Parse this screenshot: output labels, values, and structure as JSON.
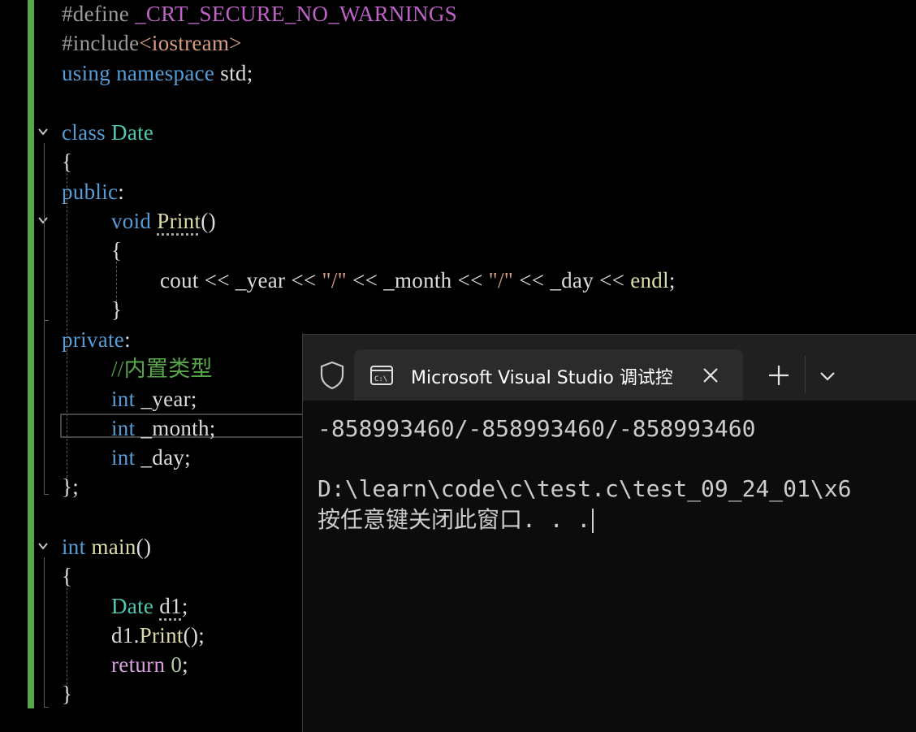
{
  "editor": {
    "lines": {
      "l1_pp": "#define",
      "l1_macro": "_CRT_SECURE_NO_WARNINGS",
      "l2_pp": "#include",
      "l2_header": "<iostream>",
      "l3_using": "using",
      "l3_namespace": "namespace",
      "l3_std": "std;",
      "l5_class": "class",
      "l5_name": "Date",
      "l6": "{",
      "l7_public": "public",
      "l7_colon": ":",
      "l8_void": "void",
      "l8_fn": "Print",
      "l8_parens": "()",
      "l9": "{",
      "l10_cout": "cout",
      "l10_op1": "<<",
      "l10_year": "_year",
      "l10_op2": "<<",
      "l10_str1": "\"/\"",
      "l10_op3": "<<",
      "l10_month": "_month",
      "l10_op4": "<<",
      "l10_str2": "\"/\"",
      "l10_op5": "<<",
      "l10_day": "_day",
      "l10_op6": "<<",
      "l10_endl": "endl",
      "l10_semi": ";",
      "l11": "}",
      "l12_private": "private",
      "l12_colon": ":",
      "l13_comment": "//内置类型",
      "l14_int": "int",
      "l14_var": "_year;",
      "l15_int": "int",
      "l15_var": "_month;",
      "l16_int": "int",
      "l16_var": "_day;",
      "l17": "};",
      "l19_int": "int",
      "l19_main": "main",
      "l19_parens": "()",
      "l20": "{",
      "l21_type": "Date",
      "l21_var": "d1",
      "l21_semi": ";",
      "l22_obj": "d1.",
      "l22_fn": "Print",
      "l22_rest": "();",
      "l23_return": "return",
      "l23_num": "0",
      "l23_semi": ";",
      "l24": "}"
    }
  },
  "terminal": {
    "tab_title": "Microsoft Visual Studio 调试控",
    "output": {
      "line1": "-858993460/-858993460/-858993460",
      "line2": "D:\\learn\\code\\c\\test.c\\test_09_24_01\\x6",
      "line3": "按任意键关闭此窗口. . ."
    }
  },
  "colors": {
    "keyword": "#569cd6",
    "type": "#4ec9b0",
    "function": "#dcdcaa",
    "macro": "#bd63c5",
    "string": "#d69d85",
    "comment": "#57a64a",
    "control": "#d8a0df",
    "change_bar": "#57a64a"
  }
}
